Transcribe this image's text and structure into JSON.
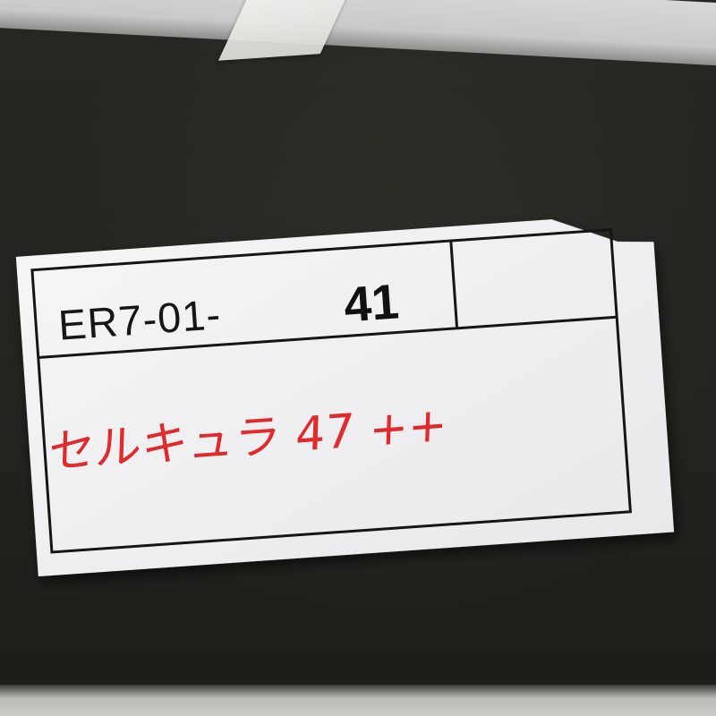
{
  "label": {
    "code_prefix": "ER7-01-",
    "code_number": "41",
    "handwritten_note": "セルキュラ 47 ++",
    "ink_color": "#e02a2d"
  }
}
